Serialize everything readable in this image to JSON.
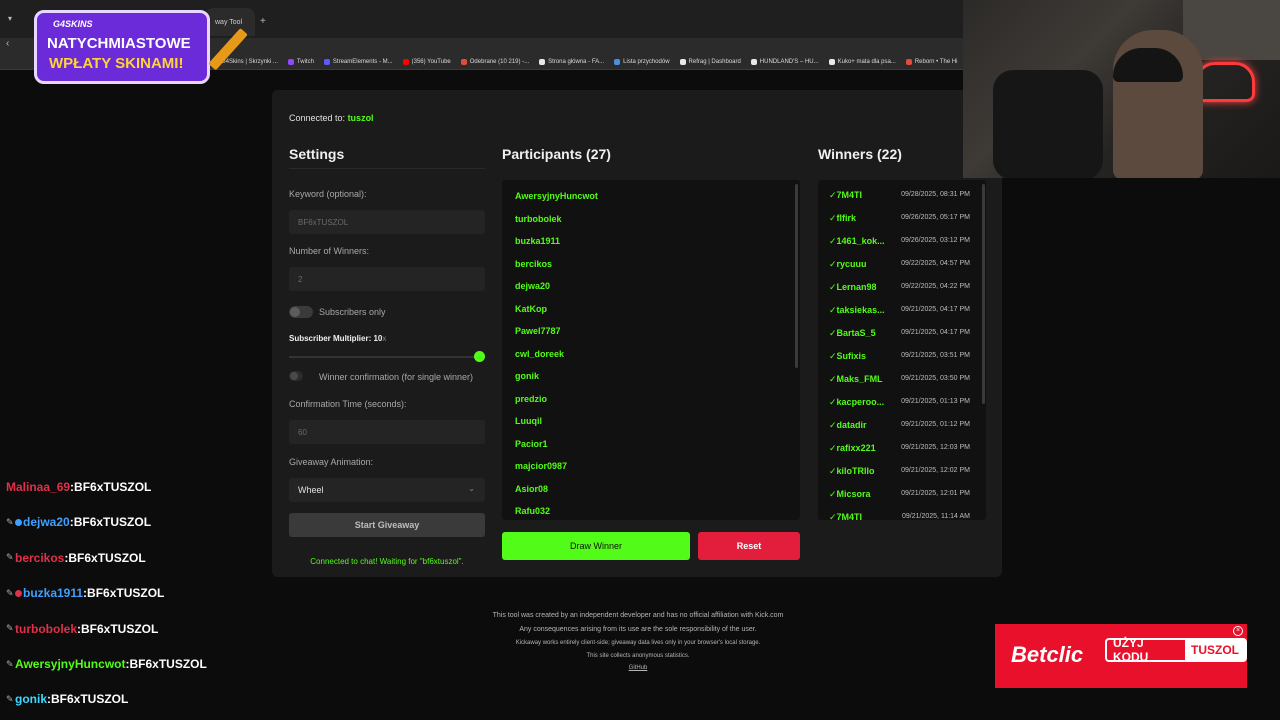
{
  "browser": {
    "tab_label": "way Tool",
    "new_tab": "+",
    "bookmarks": [
      {
        "label": "G4Skins | Skrzynki ...",
        "color": "#f0c040"
      },
      {
        "label": "Twitch",
        "color": "#9146ff"
      },
      {
        "label": "StreamElements - M...",
        "color": "#5a5aff"
      },
      {
        "label": "(356) YouTube",
        "color": "#ff0000"
      },
      {
        "label": "Odebrane (10 219) -...",
        "color": "#e04c3c"
      },
      {
        "label": "Strona główna - FA...",
        "color": "#e8e8e8"
      },
      {
        "label": "Lista przychodów",
        "color": "#4a90e2"
      },
      {
        "label": "Refrag | Dashboard",
        "color": "#e8e8e8"
      },
      {
        "label": "HUNDLAND'S – HU...",
        "color": "#e8e8e8"
      },
      {
        "label": "Kuko+ mata dla psa...",
        "color": "#e8e8e8"
      },
      {
        "label": "Reborn • The Hi",
        "color": "#e04c3c"
      }
    ]
  },
  "promo": {
    "brand": "G4SKINS",
    "line1": "NATYCHMIASTOWE",
    "line2": "WPŁATY SKINAMI!"
  },
  "panel": {
    "connected_prefix": "Connected to:",
    "channel": "tuszol",
    "settings": {
      "title": "Settings",
      "keyword_label": "Keyword (optional):",
      "keyword_placeholder": "BF6xTUSZOL",
      "winners_label": "Number of Winners:",
      "winners_value": "2",
      "subscribers_only": "Subscribers only",
      "multiplier_label": "Subscriber Multiplier:",
      "multiplier_value": "10",
      "multiplier_unit": "x",
      "multiplier_fraction": 1.0,
      "confirmation_label": "Winner confirmation (for single winner)",
      "confirmation_time_label": "Confirmation Time (seconds):",
      "confirmation_time_value": "60",
      "animation_label": "Giveaway Animation:",
      "animation_value": "Wheel",
      "start_button": "Start Giveaway",
      "status": "Connected to chat! Waiting for \"bf6xtuszol\"."
    },
    "participants": {
      "title": "Participants (27)",
      "names": [
        "AwersyjnyHuncwot",
        "turbobolek",
        "buzka1911",
        "bercikos",
        "dejwa20",
        "KatKop",
        "Pawel7787",
        "cwl_doreek",
        "gonik",
        "predzio",
        "Luuqil",
        "Pacior1",
        "majcior0987",
        "Asior08",
        "Rafu032"
      ],
      "draw_button": "Draw Winner",
      "reset_button": "Reset"
    },
    "winners": {
      "title": "Winners (22)",
      "check": "✓",
      "items": [
        {
          "name": "7M4TI",
          "date": "09/28/2025, 08:31 PM"
        },
        {
          "name": "flfirk",
          "date": "09/26/2025, 05:17 PM"
        },
        {
          "name": "1461_kok...",
          "date": "09/26/2025, 03:12 PM"
        },
        {
          "name": "rycuuu",
          "date": "09/22/2025, 04:57 PM"
        },
        {
          "name": "Lernan98",
          "date": "09/22/2025, 04:22 PM"
        },
        {
          "name": "taksiekas...",
          "date": "09/21/2025, 04:17 PM"
        },
        {
          "name": "BartaS_5",
          "date": "09/21/2025, 04:17 PM"
        },
        {
          "name": "Sufixis",
          "date": "09/21/2025, 03:51 PM"
        },
        {
          "name": "Maks_FML",
          "date": "09/21/2025, 03:50 PM"
        },
        {
          "name": "kacperoo...",
          "date": "09/21/2025, 01:13 PM"
        },
        {
          "name": "datadir",
          "date": "09/21/2025, 01:12 PM"
        },
        {
          "name": "rafixx221",
          "date": "09/21/2025, 12:03 PM"
        },
        {
          "name": "kiloTRllo",
          "date": "09/21/2025, 12:02 PM"
        },
        {
          "name": "Micsora",
          "date": "09/21/2025, 12:01 PM"
        },
        {
          "name": "7M4TI",
          "date": "09/21/2025, 11:14 AM"
        }
      ]
    }
  },
  "footer": {
    "line1": "This tool was created by an independent developer and has no official affiliation with Kick.com",
    "line2": "Any consequences arising from its use are the sole responsibility of the user.",
    "line3": "Kickaway works entirely client-side; giveaway data lives only in your browser's local storage.",
    "line4": "This site collects anonymous statistics.",
    "link": "GitHub"
  },
  "chat": [
    {
      "user": "Malinaa_69",
      "color": "#e0304a",
      "msg": "BF6xTUSZOL",
      "pen": "",
      "dot": ""
    },
    {
      "user": "dejwa20",
      "color": "#3fa0ff",
      "msg": "BF6xTUSZOL",
      "pen": "✎",
      "dot": "#3fa0ff"
    },
    {
      "user": "bercikos",
      "color": "#e0304a",
      "msg": "BF6xTUSZOL",
      "pen": "✎",
      "dot": ""
    },
    {
      "user": "buzka1911",
      "color": "#3fa0ff",
      "msg": "BF6xTUSZOL",
      "pen": "✎",
      "dot": "#e0304a"
    },
    {
      "user": "turbobolek",
      "color": "#e0304a",
      "msg": "BF6xTUSZOL",
      "pen": "✎",
      "dot": ""
    },
    {
      "user": "AwersyjnyHuncwot",
      "color": "#53fc18",
      "msg": "BF6xTUSZOL",
      "pen": "✎",
      "dot": ""
    },
    {
      "user": "gonik",
      "color": "#3fd8ff",
      "msg": "BF6xTUSZOL",
      "pen": "✎",
      "dot": ""
    }
  ],
  "ad": {
    "brand": "Betclic",
    "cta1": "UŻYJ KODU",
    "cta2": "TUSZOL"
  },
  "colors": {
    "accent": "#53fc18",
    "danger": "#e21e3c"
  }
}
